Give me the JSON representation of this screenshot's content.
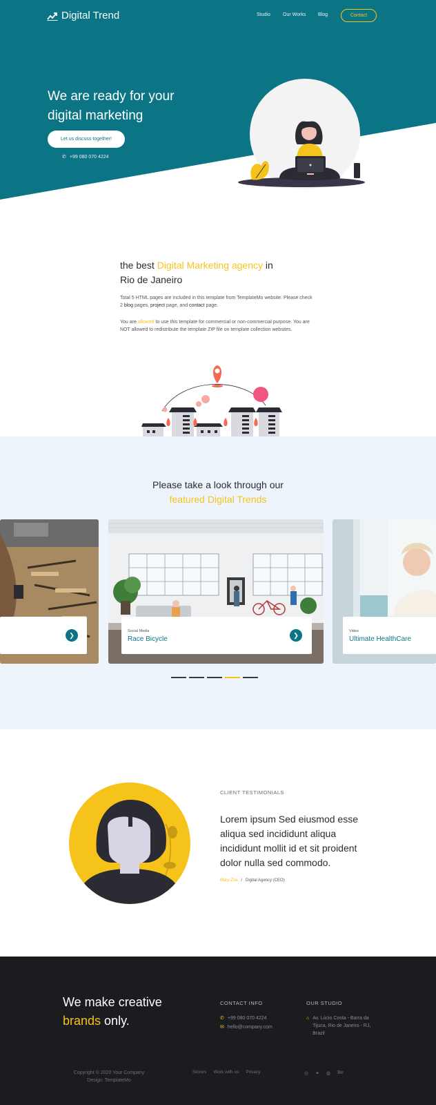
{
  "nav": {
    "brand": "Digital Trend",
    "links": [
      {
        "label": "Studio"
      },
      {
        "label": "Our Works"
      },
      {
        "label": "Blog"
      }
    ],
    "contact_label": "Contact"
  },
  "hero": {
    "title": "We are ready for your digital marketing",
    "button_label": "Let us discuss together!",
    "phone": "+99 080 070 4224"
  },
  "about": {
    "title_part1": "the best ",
    "title_accent": "Digital Marketing agency",
    "title_part2": " in Rio de Janeiro",
    "p1_part1": "Total 5 HTML pages are included in this template from TemplateMo website. Please check 2 ",
    "p1_link1": "blog",
    "p1_part2": " pages, ",
    "p1_link2": "project",
    "p1_part3": " page, and ",
    "p1_link3": "contact",
    "p1_part4": " page.",
    "p2_part1": "You are ",
    "p2_accent": "allowed",
    "p2_part2": " to use this template for commercial or non-commercial purpose. You are NOT allowed to redistribute the template ZIP file on template collection websites."
  },
  "featured": {
    "title_line1": "Please take a look through our",
    "title_accent": "featured Digital Trends",
    "cards": [
      {
        "category": "",
        "name": ""
      },
      {
        "category": "Social Media",
        "name": "Race Bicycle"
      },
      {
        "category": "Video",
        "name": "Ultimate HealthCare"
      }
    ],
    "active_dot": 3
  },
  "testimonial": {
    "label": "CLIENT TESTIMONIALS",
    "quote": "Lorem ipsum Sed eiusmod esse aliqua sed incididunt aliqua incididunt mollit id et sit proident dolor nulla sed commodo.",
    "author": "Mary Zoe",
    "separator": "/",
    "role": "Digital Agency (CEO)"
  },
  "footer": {
    "slogan_part1": "We make creative ",
    "slogan_accent": "brands",
    "slogan_part2": " only.",
    "contact_head": "CONTACT INFO",
    "phone": "+99 080 070 4224",
    "email": "hello@company.com",
    "studio_head": "OUR STUDIO",
    "address": "Av. Lúcio Costa - Barra da Tijuca, Rio de Janeiro - RJ, Brazil",
    "copyright": "Copyright © 2020 Your Company",
    "design": "Design: TemplateMo",
    "links": [
      {
        "label": "Stories"
      },
      {
        "label": "Work with us"
      },
      {
        "label": "Privacy"
      }
    ],
    "social": [
      {
        "icon": "instagram-icon",
        "glyph": "◎"
      },
      {
        "icon": "twitter-icon",
        "glyph": "✦"
      },
      {
        "icon": "dribbble-icon",
        "glyph": "◍"
      },
      {
        "icon": "behance-icon",
        "glyph": "Be"
      }
    ]
  },
  "colors": {
    "primary": "#0c7585",
    "accent": "#f6c31b",
    "dark": "#1b1c20",
    "light_bg": "#edf4fb"
  }
}
